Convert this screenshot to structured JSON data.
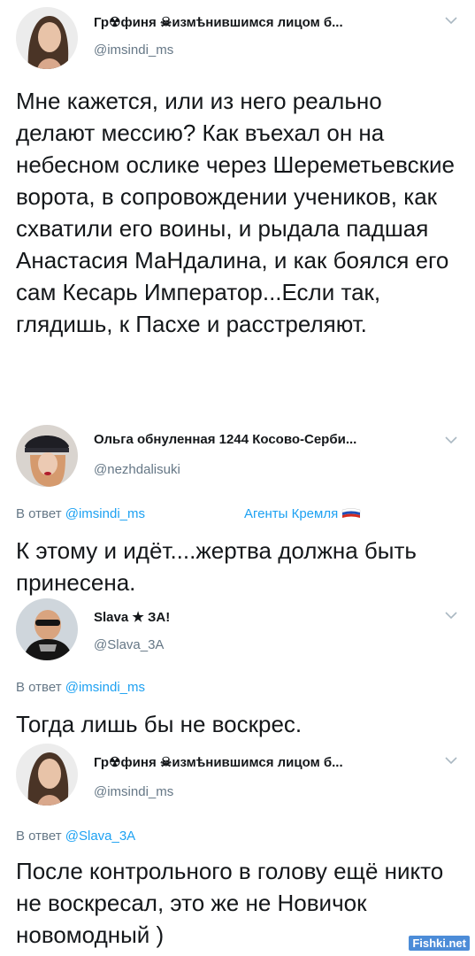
{
  "tweets": [
    {
      "name": "Гр☢финя ☠измѣнившимся лицом б...",
      "handle": "@imsindi_ms",
      "reply_prefix": "",
      "reply_to": "",
      "text": "Мне кажется, или из него реально делают мессию? Как въехал он на небесном ослике через Шереметьевские ворота, в сопровождении учеников, как схватили его воины, и рыдала падшая Анастасия МаНдалина, и как боялся его сам Кесарь Император...Если так, глядишь, к Пасхе и расстреляют."
    },
    {
      "name": "Ольга обнуленная 1244 Косово-Серби...",
      "handle": "@nezhdalisuki",
      "reply_prefix": "В ответ",
      "reply_to": "@imsindi_ms",
      "tag": "Агенты Кремля",
      "text": "К этому и идёт....жертва должна быть принесена."
    },
    {
      "name": "Slava ★ ЗА!",
      "handle": "@Slava_3A",
      "reply_prefix": "В ответ",
      "reply_to": "@imsindi_ms",
      "text": "Тогда лишь бы не воскрес."
    },
    {
      "name": "Гр☢финя ☠измѣнившимся лицом б...",
      "handle": "@imsindi_ms",
      "reply_prefix": "В ответ",
      "reply_to": "@Slava_3A",
      "text": "После контрольного в голову ещё никто не воскресал, это же не Новичок новомодный )"
    }
  ],
  "watermark": "Fishki.net",
  "colors": {
    "link": "#1da1f2",
    "muted": "#657786",
    "text": "#14171a"
  },
  "icons": [
    "chevron-down-icon",
    "russian-flag-icon"
  ]
}
